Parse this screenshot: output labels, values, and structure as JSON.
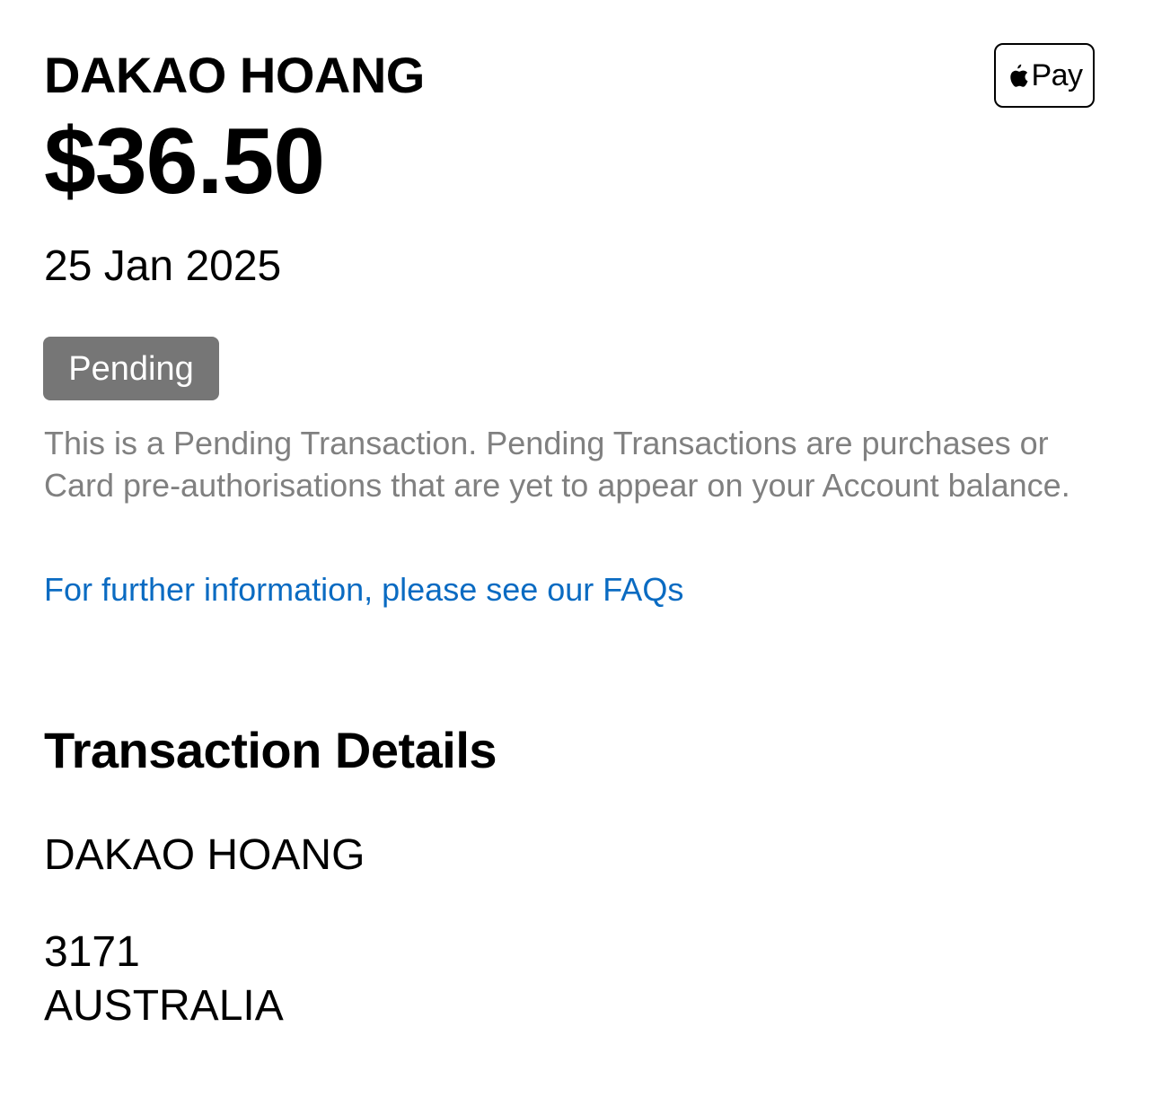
{
  "transaction": {
    "merchant": "DAKAO HOANG",
    "amount": "$36.50",
    "date": "25 Jan 2025",
    "status": "Pending",
    "payment_method": {
      "icon": "apple-logo-icon",
      "label": "Pay"
    }
  },
  "pending_info": {
    "description": "This is a Pending Transaction. Pending Transactions are purchases or Card pre-authorisations that are yet to appear on your Account balance.",
    "faq_link": "For further information, please see our FAQs"
  },
  "details": {
    "heading": "Transaction Details",
    "merchant": "DAKAO HOANG",
    "postcode": "3171",
    "country": "AUSTRALIA"
  },
  "colors": {
    "badge_background": "#767676",
    "description_text": "#808080",
    "link": "#0a6bc2"
  }
}
